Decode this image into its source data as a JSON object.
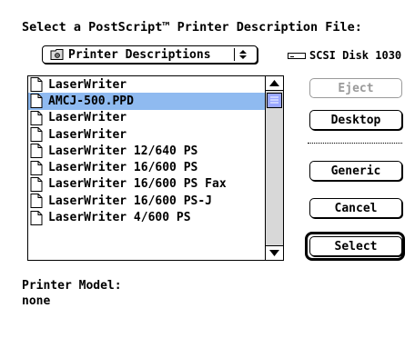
{
  "dialog": {
    "prompt": "Select a PostScript™ Printer Description File:",
    "folder_popup": {
      "label": "Printer Descriptions",
      "icon": "folder-icon",
      "arrows_icon": "updown-arrows-icon"
    },
    "disk": {
      "label": "SCSI Disk 1030",
      "icon": "hard-disk-icon"
    },
    "file_list": [
      {
        "name": "LaserWriter",
        "icon": "document-icon",
        "selected": false
      },
      {
        "name": "AMCJ-500.PPD",
        "icon": "document-icon",
        "selected": true
      },
      {
        "name": "LaserWriter",
        "icon": "document-icon",
        "selected": false
      },
      {
        "name": "LaserWriter",
        "icon": "document-icon",
        "selected": false
      },
      {
        "name": "LaserWriter 12/640 PS",
        "icon": "document-icon",
        "selected": false
      },
      {
        "name": "LaserWriter 16/600 PS",
        "icon": "document-icon",
        "selected": false
      },
      {
        "name": "LaserWriter 16/600 PS Fax",
        "icon": "document-icon",
        "selected": false
      },
      {
        "name": "LaserWriter 16/600 PS-J",
        "icon": "document-icon",
        "selected": false
      },
      {
        "name": "LaserWriter 4/600 PS",
        "icon": "document-icon",
        "selected": false
      }
    ],
    "buttons": {
      "eject": "Eject",
      "desktop": "Desktop",
      "generic": "Generic",
      "cancel": "Cancel",
      "select": "Select"
    },
    "printer_model_label": "Printer Model:",
    "printer_model_value": "none",
    "colors": {
      "selection": "#8fbaf0",
      "scroll_thumb": "#9aa7ff",
      "scroll_track": "#d8d8d8"
    }
  }
}
